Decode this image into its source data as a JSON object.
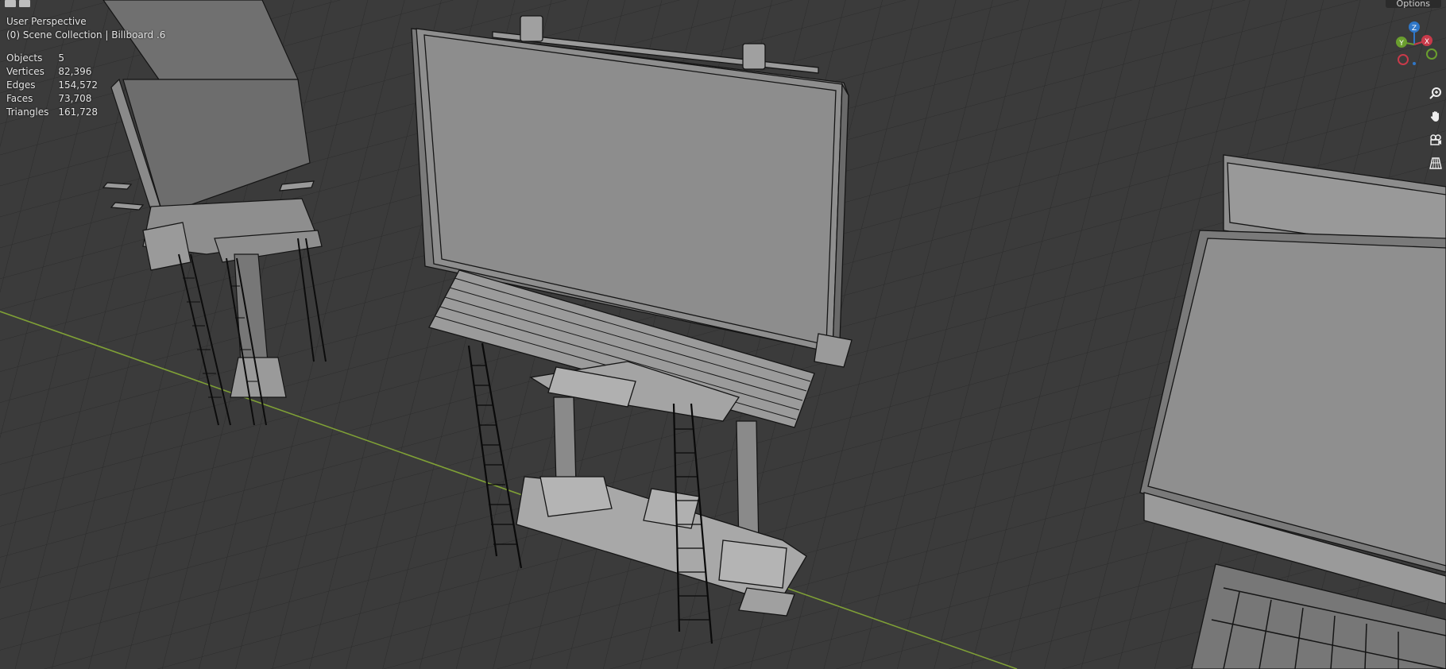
{
  "view": {
    "perspective": "User Perspective",
    "collection": "(0) Scene Collection | Billboard .6"
  },
  "stats": [
    {
      "label": "Objects",
      "value": "5"
    },
    {
      "label": "Vertices",
      "value": "82,396"
    },
    {
      "label": "Edges",
      "value": "154,572"
    },
    {
      "label": "Faces",
      "value": "73,708"
    },
    {
      "label": "Triangles",
      "value": "161,728"
    }
  ],
  "header": {
    "options_label": "Options"
  },
  "gizmo": {
    "z_label": "Z",
    "y_label": "Y",
    "x_label": "X"
  },
  "colors": {
    "background": "#3a3a3a",
    "grid_line": "#2a2a2a",
    "x_axis": "#8aa83a",
    "gizmo_x": "#c83a4a",
    "gizmo_y": "#6a9e2e",
    "gizmo_z": "#2f77c8",
    "mesh_face": "#8f8f8f",
    "mesh_edge": "#1a1a1a"
  },
  "nav_tools": [
    {
      "icon": "zoom-icon"
    },
    {
      "icon": "pan-hand-icon"
    },
    {
      "icon": "camera-view-icon"
    },
    {
      "icon": "ortho-grid-icon"
    }
  ]
}
